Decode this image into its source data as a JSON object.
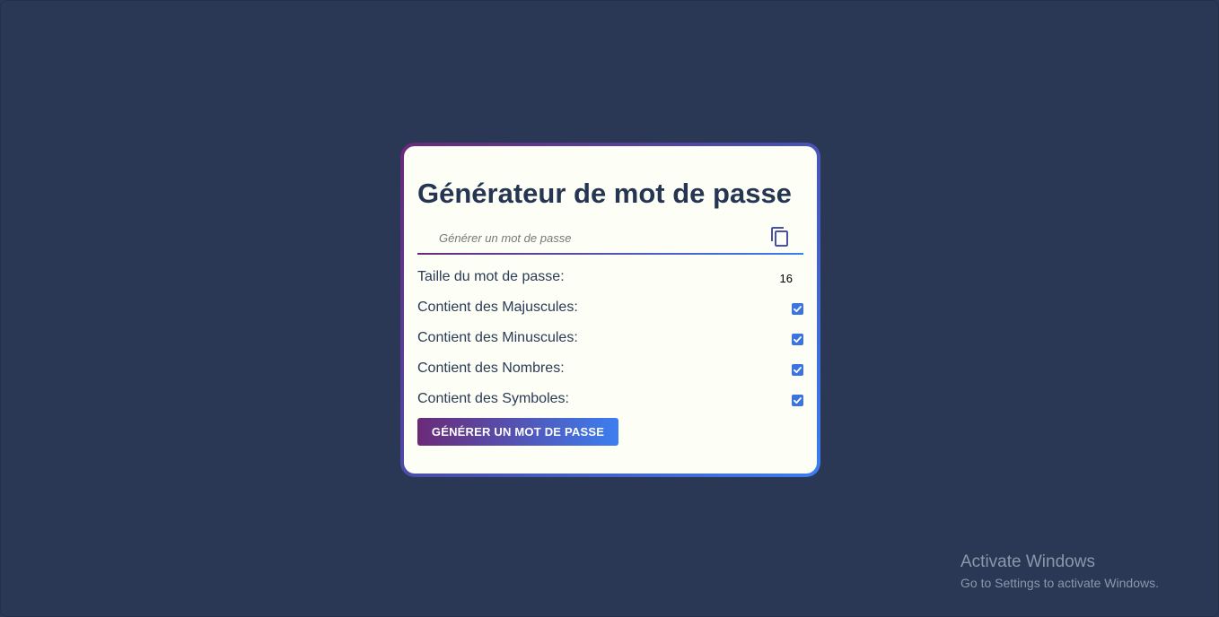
{
  "app": {
    "title": "Générateur de mot de passe"
  },
  "password": {
    "placeholder": "Générer un mot de passe",
    "copy_icon": "copy-icon"
  },
  "options": {
    "length": {
      "label": "Taille du mot de passe:",
      "value": "16"
    },
    "uppercase": {
      "label": "Contient des Majuscules:",
      "checked": true
    },
    "lowercase": {
      "label": "Contient des Minuscules:",
      "checked": true
    },
    "numbers": {
      "label": "Contient des Nombres:",
      "checked": true
    },
    "symbols": {
      "label": "Contient des Symboles:",
      "checked": true
    }
  },
  "actions": {
    "generate_label": "GÉNÉRER UN MOT DE PASSE"
  },
  "colors": {
    "background": "#2a3856",
    "card": "#fdfff7",
    "accent_start": "#6b2a78",
    "accent_end": "#3c7ef0",
    "checkbox": "#3b73e0",
    "text": "#263652"
  },
  "watermark": {
    "title": "Activate Windows",
    "subtitle": "Go to Settings to activate Windows."
  }
}
